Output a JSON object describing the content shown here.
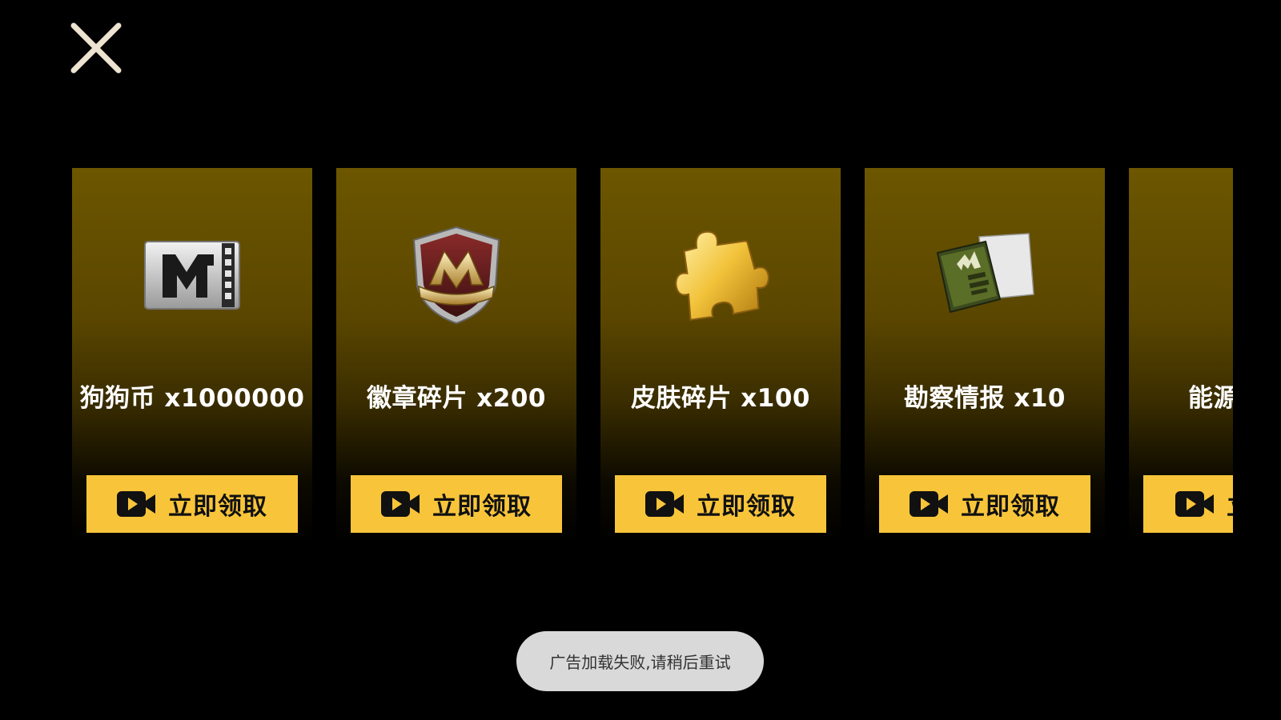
{
  "close": {
    "icon": "close-icon"
  },
  "cards": [
    {
      "icon": "m-coin-ticket-icon",
      "label": "狗狗币 x1000000",
      "button": {
        "icon": "video-camera-icon",
        "label": "立即领取"
      }
    },
    {
      "icon": "badge-shield-icon",
      "label": "徽章碎片 x200",
      "button": {
        "icon": "video-camera-icon",
        "label": "立即领取"
      }
    },
    {
      "icon": "puzzle-piece-icon",
      "label": "皮肤碎片 x100",
      "button": {
        "icon": "video-camera-icon",
        "label": "立即领取"
      }
    },
    {
      "icon": "intel-book-icon",
      "label": "勘察情报 x10",
      "button": {
        "icon": "video-camera-icon",
        "label": "立即领取"
      }
    },
    {
      "icon": "energy-item-icon",
      "label": "能源",
      "button": {
        "icon": "video-camera-icon",
        "label": "立即领取"
      }
    }
  ],
  "toast": {
    "text": "广告加载失败,请稍后重试"
  },
  "colors": {
    "background": "#000000",
    "card_top": "#6c5600",
    "button": "#f8c53a",
    "toast": "#d9d9d9",
    "close_icon": "#ede3d0"
  }
}
